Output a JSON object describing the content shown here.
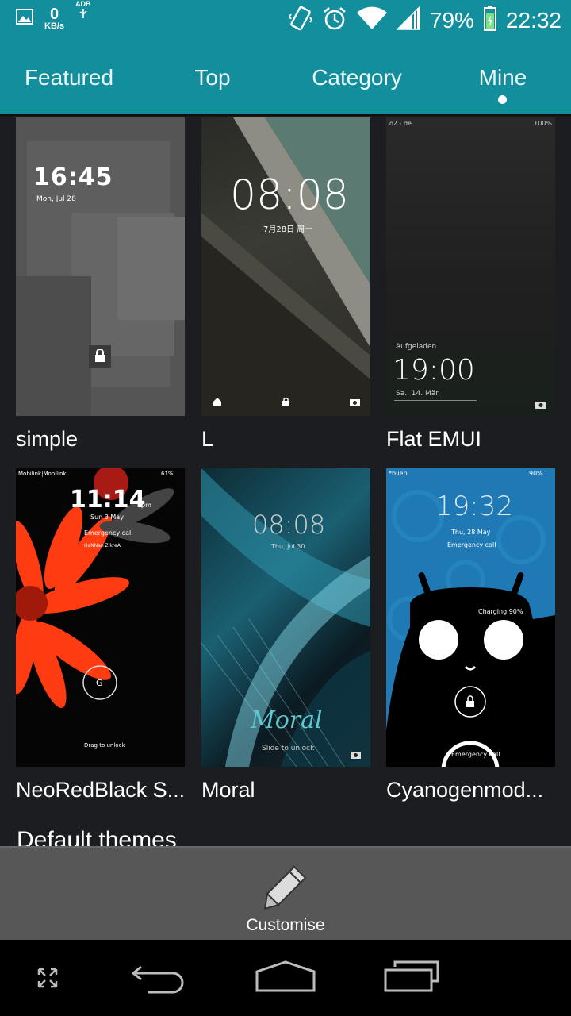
{
  "status_bar": {
    "net_speed_value": "0",
    "net_speed_unit": "KB/s",
    "adb_label": "ADB",
    "battery_percent": "79%",
    "time": "22:32",
    "icons": [
      "gallery-icon",
      "usb-icon",
      "vibrate-icon",
      "alarm-icon",
      "wifi-icon",
      "signal-icon",
      "battery-icon"
    ]
  },
  "tabs": [
    {
      "label": "Featured",
      "selected": false
    },
    {
      "label": "Top",
      "selected": false
    },
    {
      "label": "Category",
      "selected": false
    },
    {
      "label": "Mine",
      "selected": true
    }
  ],
  "themes": [
    {
      "name": "simple",
      "preview": {
        "clock": "16:45",
        "date": "Mon,  Jul 28"
      }
    },
    {
      "name": "L",
      "preview": {
        "clock": "08:08",
        "date": "7月28日 周一"
      }
    },
    {
      "name": "Flat EMUI",
      "preview": {
        "clock": "19:00",
        "date": "Sa., 14. Mär.",
        "carrier": "o2 - de",
        "battery": "100%",
        "status": "Aufgeladen"
      }
    },
    {
      "name": "NeoRedBlack S...",
      "preview": {
        "clock": "11:14",
        "ampm": "pm",
        "date": "Sun 3 May",
        "carrier": "Mobilink|Mobilink",
        "battery": "61%",
        "emergency": "Emergency call",
        "owner": "HaNNan ZikreA",
        "hint": "Drag to unlock"
      }
    },
    {
      "name": "Moral",
      "preview": {
        "clock": "08:08",
        "date": "Thu, Jul 30",
        "logo": "Moral",
        "hint": "Slide to unlock"
      }
    },
    {
      "name": "Cyanogenmod...",
      "preview": {
        "clock": "19:32",
        "date": "Thu, 28 May",
        "carrier": "*bliep",
        "battery": "90%",
        "emergency": "Emergency call",
        "charging": "Charging 90%",
        "ring_text": "Emergency call"
      }
    }
  ],
  "section": {
    "title": "Default themes"
  },
  "customise": {
    "label": "Customise",
    "icon": "pencil-icon"
  },
  "nav": {
    "icons": [
      "expand-icon",
      "back-icon",
      "home-icon",
      "recents-icon"
    ]
  },
  "colors": {
    "accent": "#128e9c",
    "background": "#1b1d20",
    "bar": "#575757"
  }
}
